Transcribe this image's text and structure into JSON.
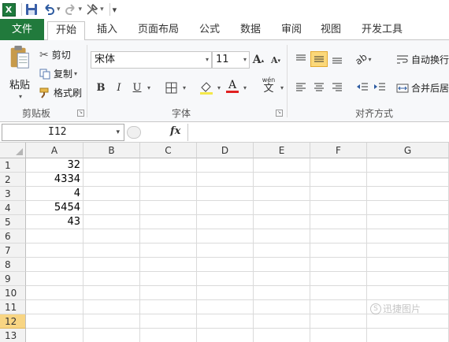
{
  "quick_access": {
    "app_icon": "excel-icon",
    "save_icon": "save-icon",
    "undo_icon": "undo-icon",
    "redo_icon": "redo-icon",
    "customize_icon": "tools-icon"
  },
  "tabs": [
    "文件",
    "开始",
    "插入",
    "页面布局",
    "公式",
    "数据",
    "审阅",
    "视图",
    "开发工具"
  ],
  "active_tab": "开始",
  "clipboard": {
    "paste": "粘贴",
    "cut": "剪切",
    "copy": "复制",
    "format_painter": "格式刷",
    "group_label": "剪贴板"
  },
  "font": {
    "font_name": "宋体",
    "font_size": "11",
    "bold": "B",
    "italic": "I",
    "underline": "U",
    "grow": "A",
    "shrink": "A",
    "font_color": "A",
    "phonetic": "wén",
    "phonetic_char": "文",
    "group_label": "字体"
  },
  "alignment": {
    "wrap_text": "自动换行",
    "merge_center": "合并后居",
    "group_label": "对齐方式"
  },
  "formula_bar": {
    "name_box": "I12",
    "fx": "fx",
    "formula": ""
  },
  "columns": [
    "A",
    "B",
    "C",
    "D",
    "E",
    "F",
    "G"
  ],
  "rows": [
    "1",
    "2",
    "3",
    "4",
    "5",
    "6",
    "7",
    "8",
    "9",
    "10",
    "11",
    "12",
    "13"
  ],
  "selected_row": "12",
  "cells": {
    "A1": "32",
    "A2": "4334",
    "A3": "4",
    "A4": "5454",
    "A5": "43"
  },
  "watermark": "迅捷图片"
}
